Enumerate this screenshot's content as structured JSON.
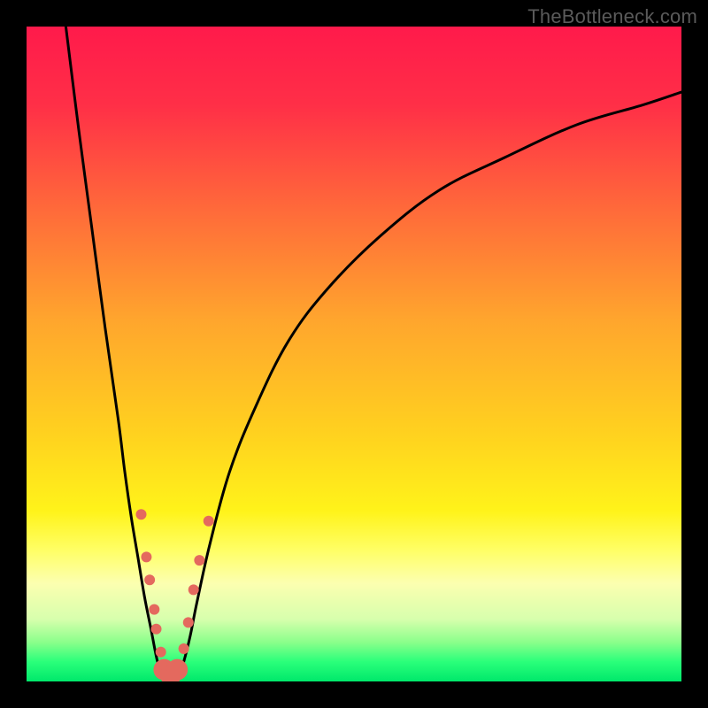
{
  "watermark": "TheBottleneck.com",
  "chart_data": {
    "type": "line",
    "title": "",
    "xlabel": "",
    "ylabel": "",
    "xlim": [
      0,
      100
    ],
    "ylim": [
      0,
      100
    ],
    "grid": false,
    "legend": false,
    "gradient_stops": [
      {
        "offset": 0.0,
        "color": "#ff1a4b"
      },
      {
        "offset": 0.12,
        "color": "#ff2f47"
      },
      {
        "offset": 0.28,
        "color": "#ff6a3a"
      },
      {
        "offset": 0.45,
        "color": "#ffa62d"
      },
      {
        "offset": 0.62,
        "color": "#ffd11f"
      },
      {
        "offset": 0.74,
        "color": "#fff31a"
      },
      {
        "offset": 0.8,
        "color": "#ffff66"
      },
      {
        "offset": 0.85,
        "color": "#fcffb0"
      },
      {
        "offset": 0.905,
        "color": "#d7ffad"
      },
      {
        "offset": 0.94,
        "color": "#8bff8b"
      },
      {
        "offset": 0.97,
        "color": "#2aff7a"
      },
      {
        "offset": 1.0,
        "color": "#00e86b"
      }
    ],
    "series": [
      {
        "name": "curve-left",
        "x": [
          6,
          8,
          10,
          12,
          14,
          15,
          16,
          17,
          18,
          19,
          20,
          21
        ],
        "y": [
          100,
          84,
          69,
          54,
          40,
          32,
          25,
          19,
          13,
          8,
          3,
          0
        ]
      },
      {
        "name": "curve-right",
        "x": [
          23,
          24,
          25,
          26,
          28,
          31,
          35,
          40,
          46,
          54,
          63,
          73,
          84,
          94,
          100
        ],
        "y": [
          0,
          3,
          7,
          12,
          21,
          32,
          42,
          52,
          60,
          68,
          75,
          80,
          85,
          88,
          90
        ]
      }
    ],
    "markers": {
      "color": "#e4695e",
      "radius_small": 6,
      "radius_large": 12,
      "points": [
        {
          "x": 17.5,
          "y": 25.5,
          "r": "small"
        },
        {
          "x": 18.3,
          "y": 19.0,
          "r": "small"
        },
        {
          "x": 18.8,
          "y": 15.5,
          "r": "small"
        },
        {
          "x": 19.5,
          "y": 11.0,
          "r": "small"
        },
        {
          "x": 19.8,
          "y": 8.0,
          "r": "small"
        },
        {
          "x": 20.5,
          "y": 4.5,
          "r": "small"
        },
        {
          "x": 21.0,
          "y": 1.8,
          "r": "large"
        },
        {
          "x": 22.0,
          "y": 1.0,
          "r": "large"
        },
        {
          "x": 23.0,
          "y": 1.8,
          "r": "large"
        },
        {
          "x": 24.0,
          "y": 5.0,
          "r": "small"
        },
        {
          "x": 24.7,
          "y": 9.0,
          "r": "small"
        },
        {
          "x": 25.5,
          "y": 14.0,
          "r": "small"
        },
        {
          "x": 26.4,
          "y": 18.5,
          "r": "small"
        },
        {
          "x": 27.8,
          "y": 24.5,
          "r": "small"
        }
      ]
    }
  }
}
